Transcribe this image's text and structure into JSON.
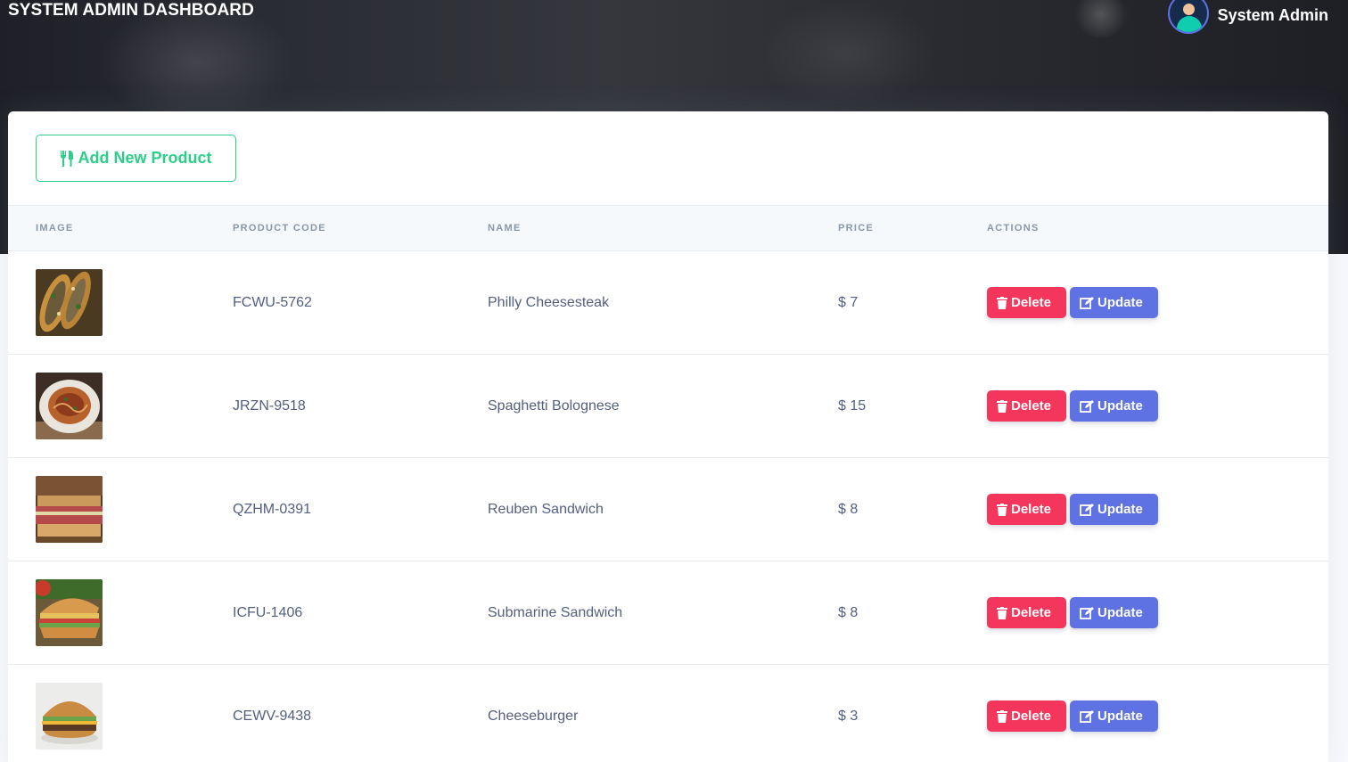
{
  "app": {
    "title": "SYSTEM ADMIN DASHBOARD"
  },
  "user": {
    "name": "System Admin",
    "avatar_icon": "user-avatar-icon"
  },
  "toolbar": {
    "add_label": "Add New Product",
    "add_icon": "utensils-icon"
  },
  "table": {
    "headers": {
      "image": "IMAGE",
      "code": "PRODUCT CODE",
      "name": "NAME",
      "price": "PRICE",
      "actions": "ACTIONS"
    },
    "actions": {
      "delete_label": "Delete",
      "update_label": "Update",
      "delete_icon": "trash-icon",
      "update_icon": "edit-icon"
    },
    "rows": [
      {
        "code": "FCWU-5762",
        "name": "Philly Cheesesteak",
        "price": "$ 7",
        "image": "philly-cheesesteak-photo"
      },
      {
        "code": "JRZN-9518",
        "name": "Spaghetti Bolognese",
        "price": "$ 15",
        "image": "spaghetti-bolognese-photo"
      },
      {
        "code": "QZHM-0391",
        "name": "Reuben Sandwich",
        "price": "$ 8",
        "image": "reuben-sandwich-photo"
      },
      {
        "code": "ICFU-1406",
        "name": "Submarine Sandwich",
        "price": "$ 8",
        "image": "submarine-sandwich-photo"
      },
      {
        "code": "CEWV-9438",
        "name": "Cheeseburger",
        "price": "$ 3",
        "image": "cheeseburger-photo"
      }
    ]
  },
  "colors": {
    "success": "#2dce89",
    "danger": "#f5365c",
    "primary": "#5e72e4",
    "header_dark": "#2a2c33"
  }
}
